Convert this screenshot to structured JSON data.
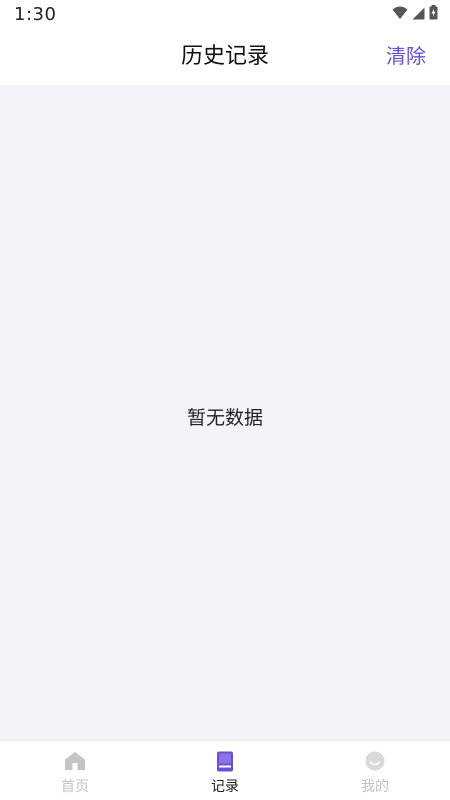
{
  "status_bar": {
    "time": "1:30",
    "icons": [
      "wifi-icon",
      "cellular-signal-icon",
      "battery-charging-icon"
    ]
  },
  "header": {
    "title": "历史记录",
    "clear_label": "清除"
  },
  "content": {
    "empty_text": "暂无数据"
  },
  "bottom_nav": {
    "items": [
      {
        "label": "首页",
        "icon": "home-icon",
        "active": false
      },
      {
        "label": "记录",
        "icon": "book-icon",
        "active": true
      },
      {
        "label": "我的",
        "icon": "smiley-face-icon",
        "active": false
      }
    ]
  },
  "colors": {
    "accent": "#6b4fd3",
    "content_background": "#f4f3f9",
    "inactive_nav": "#c2c2c2",
    "active_nav_label": "#222222"
  }
}
